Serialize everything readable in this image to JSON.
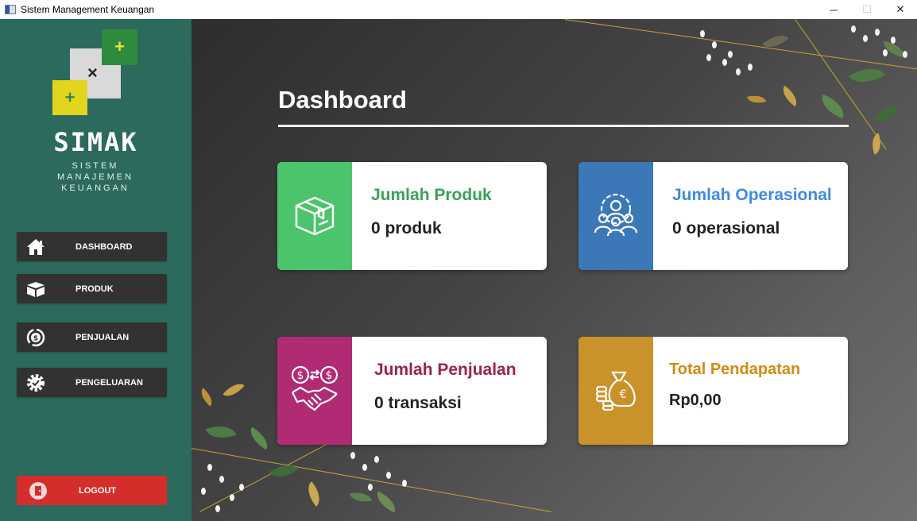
{
  "window": {
    "title": "Sistem Management Keuangan",
    "minimize": "─",
    "maximize": "☐",
    "close": "✕"
  },
  "brand": {
    "name": "SIMAK",
    "subtitle_line1": "SISTEM MANAJEMEN",
    "subtitle_line2": "KEUANGAN",
    "logo_plus": "+",
    "logo_x": "×"
  },
  "nav": {
    "dashboard": "DASHBOARD",
    "produk": "PRODUK",
    "penjualan": "PENJUALAN",
    "pengeluaran": "PENGELUARAN",
    "logout": "LOGOUT"
  },
  "page": {
    "title": "Dashboard"
  },
  "cards": {
    "produk": {
      "title": "Jumlah Produk",
      "value": "0 produk",
      "accent": "#4bc46b",
      "title_color": "#3aa05a",
      "icon": "box-icon"
    },
    "operasional": {
      "title": "Jumlah Operasional",
      "value": "0 operasional",
      "accent": "#3c77b8",
      "title_color": "#3f8be0",
      "icon": "team-gear-icon"
    },
    "penjualan": {
      "title": "Jumlah Penjualan",
      "value": "0 transaksi",
      "accent": "#b02a74",
      "title_color": "#9b2446",
      "icon": "handshake-money-icon"
    },
    "pendapatan": {
      "title": "Total Pendapatan",
      "value": "Rp0,00",
      "accent": "#c9922a",
      "title_color": "#d38a12",
      "icon": "money-bag-icon"
    }
  },
  "colors": {
    "sidebar": "#2b6a5c",
    "nav_button": "#323232",
    "logout_button": "#d42e2c"
  }
}
